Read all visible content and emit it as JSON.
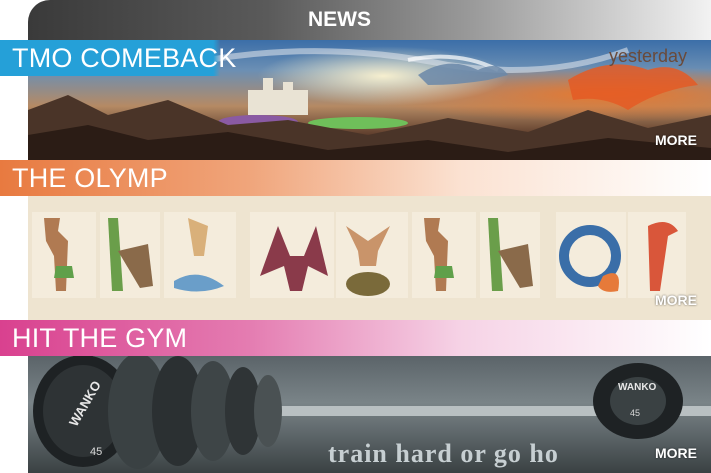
{
  "header": {
    "title": "NEWS"
  },
  "news_items": [
    {
      "title": "TMO COMEBACK",
      "timestamp": "yesterday",
      "more_label": "MORE"
    },
    {
      "title": "THE OLYMP",
      "more_label": "MORE"
    },
    {
      "title": "HIT THE GYM",
      "more_label": "MORE"
    }
  ],
  "gym_slogan": "train hard or go ho",
  "plate_brand": "WANKO",
  "plate_weight": "45",
  "colors": {
    "accent_blue": "#25a0d8",
    "accent_orange": "#e87a40",
    "accent_pink": "#d9418f"
  }
}
